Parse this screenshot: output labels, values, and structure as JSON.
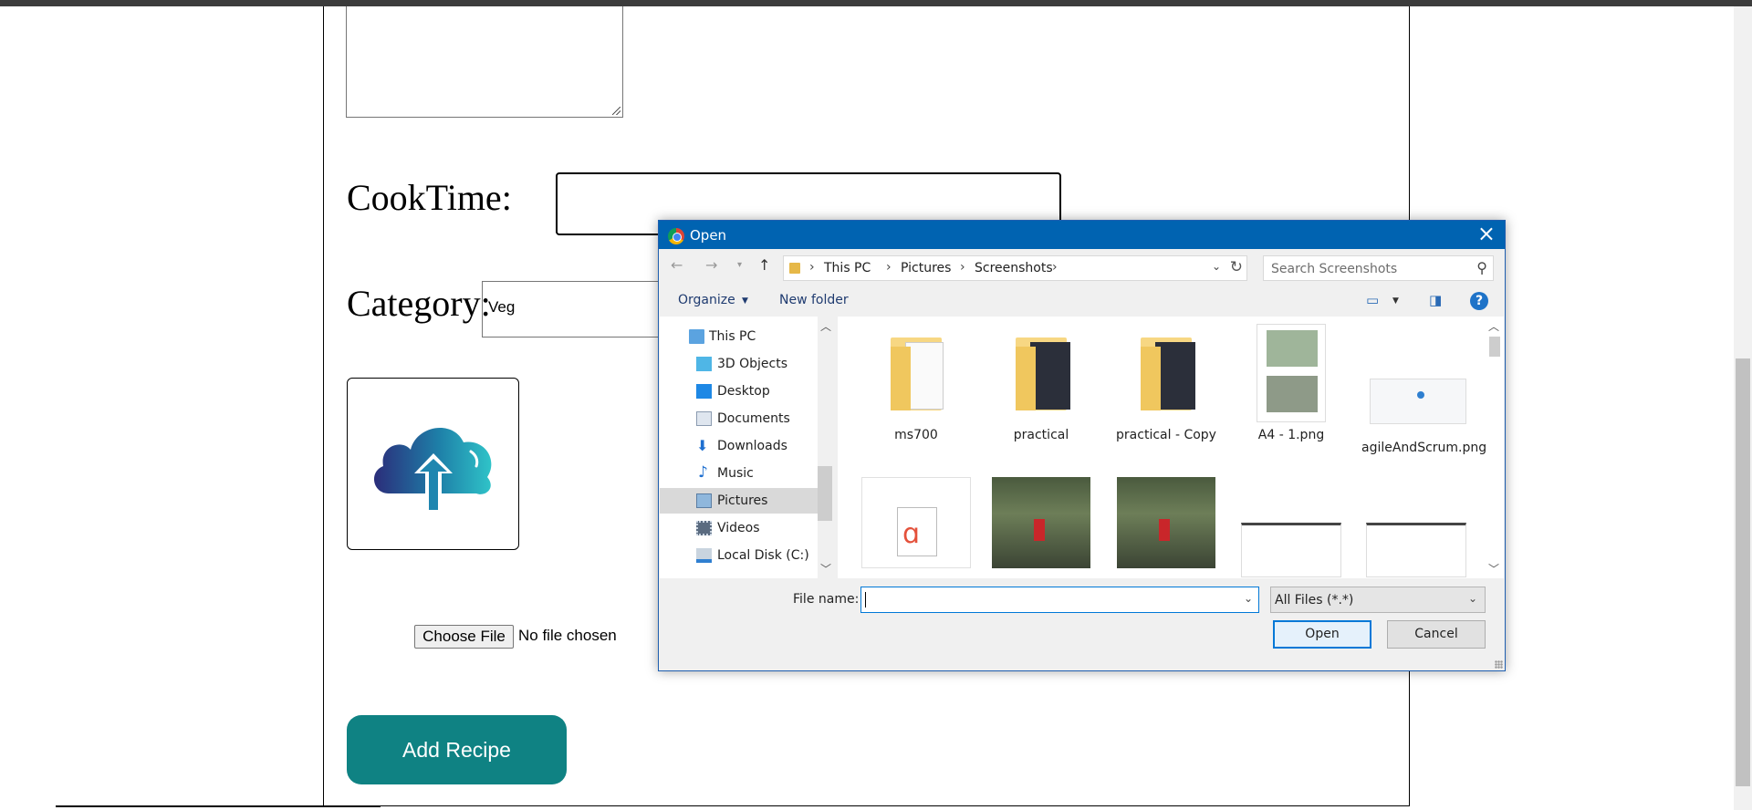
{
  "form": {
    "cooktime_label": "CookTime:",
    "category_label": "Category:",
    "category_value": "Veg",
    "choose_file_label": "Choose File",
    "no_file_text": "No file chosen",
    "add_recipe_label": "Add Recipe"
  },
  "dialog": {
    "title": "Open",
    "close_icon": "×",
    "breadcrumb": [
      "This PC",
      "Pictures",
      "Screenshots"
    ],
    "search_placeholder": "Search Screenshots",
    "organize_label": "Organize",
    "new_folder_label": "New folder",
    "help_label": "?",
    "tree": [
      {
        "label": "This PC",
        "icon": "pc-icon"
      },
      {
        "label": "3D Objects",
        "icon": "cube-icon"
      },
      {
        "label": "Desktop",
        "icon": "desktop-icon"
      },
      {
        "label": "Documents",
        "icon": "documents-icon"
      },
      {
        "label": "Downloads",
        "icon": "download-icon"
      },
      {
        "label": "Music",
        "icon": "music-icon"
      },
      {
        "label": "Pictures",
        "icon": "pictures-icon",
        "selected": true
      },
      {
        "label": "Videos",
        "icon": "videos-icon"
      },
      {
        "label": "Local Disk (C:)",
        "icon": "disk-icon"
      }
    ],
    "files": [
      {
        "name": "ms700",
        "type": "folder"
      },
      {
        "name": "practical",
        "type": "folder"
      },
      {
        "name": "practical - Copy",
        "type": "folder"
      },
      {
        "name": "A4 - 1.png",
        "type": "image"
      },
      {
        "name": "agileAndScrum.png",
        "type": "image"
      },
      {
        "name": "",
        "type": "pdf"
      },
      {
        "name": "",
        "type": "photo"
      },
      {
        "name": "",
        "type": "photo"
      },
      {
        "name": "",
        "type": "image"
      },
      {
        "name": "",
        "type": "image"
      }
    ],
    "file_name_label": "File name:",
    "file_name_value": "",
    "file_type_value": "All Files (*.*)",
    "open_label": "Open",
    "cancel_label": "Cancel"
  }
}
